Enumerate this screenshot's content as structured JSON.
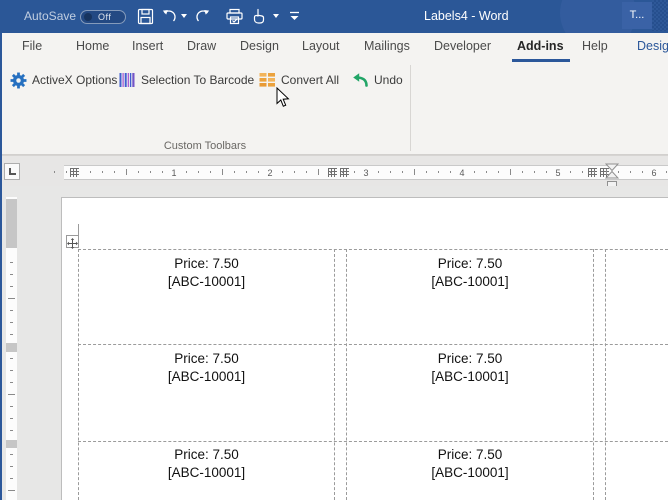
{
  "colors": {
    "titlebar": "#2b5797",
    "accent": "#2b579a",
    "ribbon_bg": "#f4f3f1",
    "gear_blue": "#2670c0",
    "barcode_blue": "#3f5fd0",
    "barcode_purple": "#a24fd0",
    "grid_orange": "#eba23d",
    "undo_green": "#22a567"
  },
  "title_bar": {
    "autosave_label": "AutoSave",
    "autosave_state": "Off",
    "title": "Labels4 - Word",
    "user_button": "T..."
  },
  "ribbon": {
    "tabs": [
      "File",
      "Home",
      "Insert",
      "Draw",
      "Design",
      "Layout",
      "Mailings",
      "Developer",
      "Add-ins",
      "Help",
      "Design"
    ],
    "active_tab": "Add-ins",
    "buttons": [
      {
        "label": "ActiveX Options",
        "icon": "gear-icon"
      },
      {
        "label": "Selection To Barcode",
        "icon": "barcode-icon"
      },
      {
        "label": "Convert All",
        "icon": "grid-icon"
      },
      {
        "label": "Undo",
        "icon": "undo-arrow-icon"
      }
    ],
    "group_label": "Custom Toolbars"
  },
  "ruler": {
    "numbers": [
      "1",
      "2",
      "3",
      "4",
      "5",
      "6"
    ]
  },
  "document": {
    "rows": [
      {
        "cells": [
          {
            "line1": "Price: 7.50",
            "line2": "[ABC-10001]"
          },
          {
            "line1": "Price: 7.50",
            "line2": "[ABC-10001]"
          }
        ]
      },
      {
        "cells": [
          {
            "line1": "Price: 7.50",
            "line2": "[ABC-10001]"
          },
          {
            "line1": "Price: 7.50",
            "line2": "[ABC-10001]"
          }
        ]
      },
      {
        "cells": [
          {
            "line1": "Price: 7.50",
            "line2": "[ABC-10001]"
          },
          {
            "line1": "Price: 7.50",
            "line2": "[ABC-10001]"
          }
        ]
      }
    ]
  }
}
